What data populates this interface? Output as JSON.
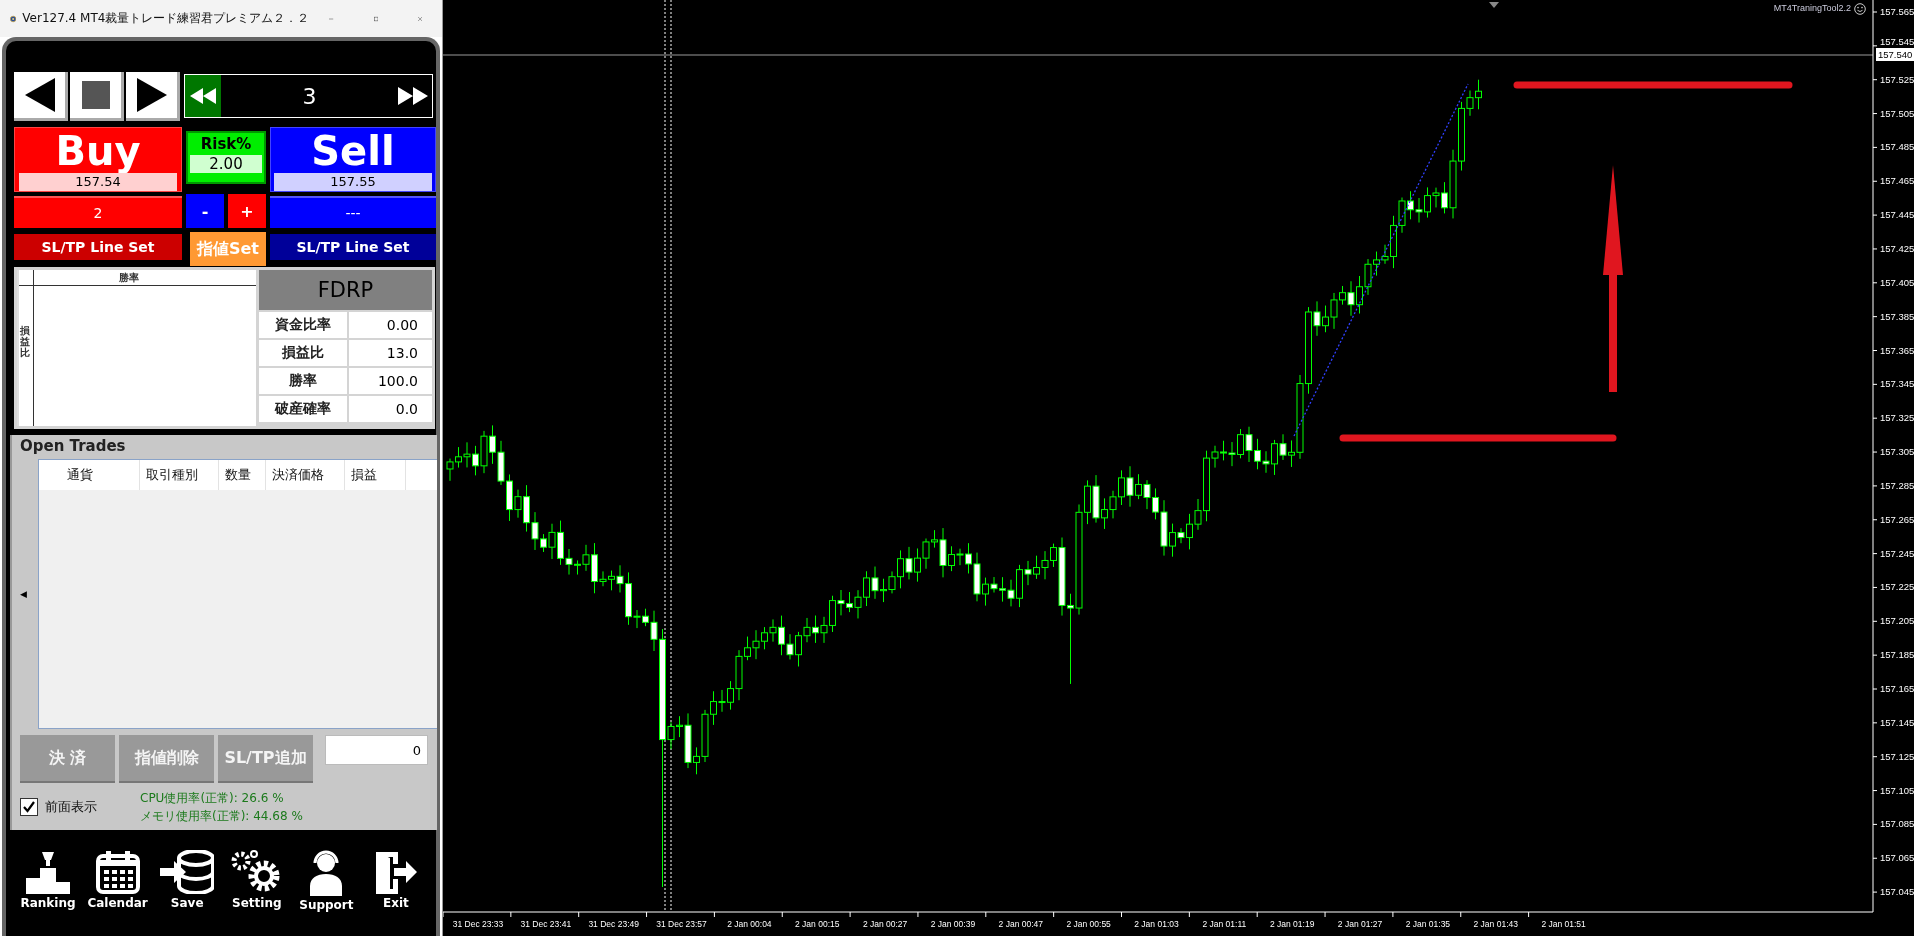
{
  "window": {
    "title": "Ver127.4 MT4裁量トレード練習君プレミアム２．２"
  },
  "playback": {
    "speed": "3"
  },
  "buy": {
    "label": "Buy",
    "price": "157.54",
    "lots": "2",
    "line_set": "SL/TP Line Set"
  },
  "risk": {
    "label": "Risk%",
    "value": "2.00",
    "minus": "-",
    "plus": "+",
    "limit_set": "指値Set"
  },
  "sell": {
    "label": "Sell",
    "price": "157.55",
    "lots": "---",
    "line_set": "SL/TP Line Set"
  },
  "fdrp": {
    "x_axis_label": "勝率",
    "y_axis_label": "損益比",
    "title": "FDRP",
    "rows": [
      {
        "label": "資金比率",
        "value": "0.00"
      },
      {
        "label": "損益比",
        "value": "13.0"
      },
      {
        "label": "勝率",
        "value": "100.0"
      },
      {
        "label": "破産確率",
        "value": "0.0"
      }
    ]
  },
  "open_trades": {
    "title": "Open Trades",
    "collapse": "◀",
    "columns": [
      "通貨",
      "取引種別",
      "数量",
      "決済価格",
      "損益"
    ],
    "buttons": [
      "決 済",
      "指値削除",
      "SL/TP追加"
    ],
    "amount": "0"
  },
  "front_display": {
    "label": "前面表示",
    "checked": true
  },
  "usage": [
    "CPU使用率(正常): 26.6 %",
    "メモリ使用率(正常): 44.68 %"
  ],
  "toolbar": [
    {
      "label": "Ranking"
    },
    {
      "label": "Calendar"
    },
    {
      "label": "Save"
    },
    {
      "label": "Setting"
    },
    {
      "label": "Support"
    },
    {
      "label": "Exit"
    }
  ],
  "chart": {
    "tool_label": "MT4TraningTool2.2",
    "current_price": "157.540",
    "price_labels": [
      "157.565",
      "157.545",
      "157.525",
      "157.505",
      "157.485",
      "157.465",
      "157.445",
      "157.425",
      "157.405",
      "157.385",
      "157.365",
      "157.345",
      "157.325",
      "157.305",
      "157.285",
      "157.265",
      "157.245",
      "157.225",
      "157.205",
      "157.185",
      "157.165",
      "157.145",
      "157.125",
      "157.105",
      "157.085",
      "157.065",
      "157.045"
    ],
    "time_labels": [
      "31 Dec 23:33",
      "31 Dec 23:41",
      "31 Dec 23:49",
      "31 Dec 23:57",
      "2 Jan 00:04",
      "2 Jan 00:15",
      "2 Jan 00:27",
      "2 Jan 00:39",
      "2 Jan 00:47",
      "2 Jan 00:55",
      "2 Jan 01:03",
      "2 Jan 01:11",
      "2 Jan 01:19",
      "2 Jan 01:27",
      "2 Jan 01:35",
      "2 Jan 01:43",
      "2 Jan 01:51"
    ]
  }
}
